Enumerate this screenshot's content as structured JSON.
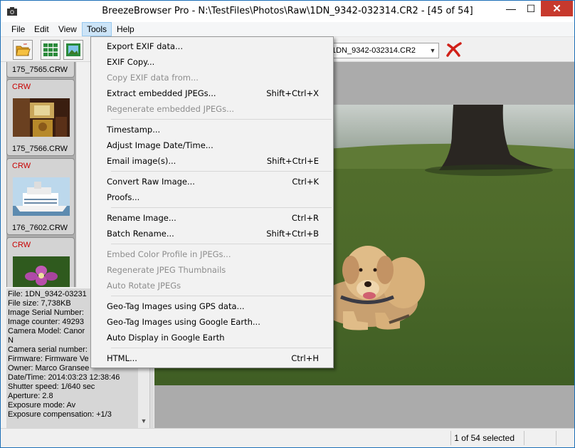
{
  "window": {
    "title": "BreezeBrowser Pro - N:\\TestFiles\\Photos\\Raw\\1DN_9342-032314.CR2 - [45 of 54]",
    "minimize": "—",
    "maximize": "☐",
    "close": "✕"
  },
  "menubar": {
    "items": [
      "File",
      "Edit",
      "View",
      "Tools",
      "Help"
    ]
  },
  "toolbar": {
    "file_combo": "1DN_9342-032314.CR2"
  },
  "thumbnails": [
    {
      "tag": "",
      "name": "175_7565.CRW"
    },
    {
      "tag": "CRW",
      "name": "175_7566.CRW"
    },
    {
      "tag": "CRW",
      "name": "176_7602.CRW"
    },
    {
      "tag": "CRW",
      "name": ""
    }
  ],
  "info_lines": [
    "File: 1DN_9342-03231",
    "File size: 7,738KB",
    "Image Serial Number:",
    "Image counter: 49293",
    "Camera Model: Canor",
    "N",
    "Camera serial number:",
    "Firmware: Firmware Ve",
    "Owner: Marco Gransee",
    "Date/Time: 2014:03:23 12:38:46",
    "Shutter speed: 1/640 sec",
    "Aperture: 2.8",
    "Exposure mode: Av",
    "Exposure compensation: +1/3"
  ],
  "status": {
    "selected": "1 of 54 selected"
  },
  "tools_menu": [
    {
      "label": "Export EXIF data...",
      "shortcut": "",
      "disabled": false
    },
    {
      "label": "EXIF Copy...",
      "shortcut": "",
      "disabled": false
    },
    {
      "label": "Copy EXIF data from...",
      "shortcut": "",
      "disabled": true
    },
    {
      "label": "Extract embedded JPEGs...",
      "shortcut": "Shift+Ctrl+X",
      "disabled": false
    },
    {
      "label": "Regenerate embedded JPEGs...",
      "shortcut": "",
      "disabled": true
    },
    {
      "label": "Timestamp...",
      "shortcut": "",
      "disabled": false
    },
    {
      "label": "Adjust Image Date/Time...",
      "shortcut": "",
      "disabled": false
    },
    {
      "label": "Email image(s)...",
      "shortcut": "Shift+Ctrl+E",
      "disabled": false
    },
    {
      "label": "Convert Raw Image...",
      "shortcut": "Ctrl+K",
      "disabled": false
    },
    {
      "label": "Proofs...",
      "shortcut": "",
      "disabled": false
    },
    {
      "label": "Rename Image...",
      "shortcut": "Ctrl+R",
      "disabled": false
    },
    {
      "label": "Batch Rename...",
      "shortcut": "Shift+Ctrl+B",
      "disabled": false
    },
    {
      "label": "Embed Color Profile in JPEGs...",
      "shortcut": "",
      "disabled": true
    },
    {
      "label": "Regenerate JPEG Thumbnails",
      "shortcut": "",
      "disabled": true
    },
    {
      "label": "Auto Rotate JPEGs",
      "shortcut": "",
      "disabled": true
    },
    {
      "label": "Geo-Tag Images using GPS data...",
      "shortcut": "",
      "disabled": false
    },
    {
      "label": "Geo-Tag Images using Google Earth...",
      "shortcut": "",
      "disabled": false
    },
    {
      "label": "Auto Display in Google Earth",
      "shortcut": "",
      "disabled": false
    },
    {
      "label": "HTML...",
      "shortcut": "Ctrl+H",
      "disabled": false
    }
  ],
  "colors": {
    "close_button": "#c7392d",
    "menu_highlight": "#cce4f7",
    "raw_tag": "#c80000",
    "disabled_text": "#8d8d8d"
  }
}
